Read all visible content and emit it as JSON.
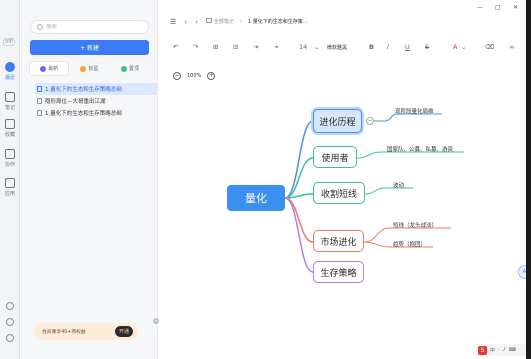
{
  "rail": {
    "badge": "VIP",
    "items": [
      {
        "label": "最近",
        "icon": "clock-icon",
        "active": true
      },
      {
        "label": "笔记",
        "icon": "note-icon",
        "active": false
      },
      {
        "label": "收藏",
        "icon": "bookmark-icon",
        "active": false
      },
      {
        "label": "协作",
        "icon": "team-icon",
        "active": false
      },
      {
        "label": "应用",
        "icon": "grid-icon",
        "active": false
      }
    ]
  },
  "sidebar": {
    "search_placeholder": "搜索",
    "new_button": "+ 新建",
    "tabs": [
      {
        "label": "最新",
        "color": "#7b5cf6"
      },
      {
        "label": "标星",
        "color": "#f6a623"
      },
      {
        "label": "置顶",
        "color": "#34c28a"
      }
    ],
    "files": [
      {
        "title": "1.量化下的生态和生存策略总纲",
        "active": true
      },
      {
        "title": "隐形周位—大哥重出江湖",
        "active": false
      },
      {
        "title": "1.量化下的生态和生存策略总纲",
        "active": false
      }
    ],
    "promo": {
      "text": "会员尊享40+项权益",
      "button": "开通"
    }
  },
  "header": {
    "breadcrumb_root": "全部笔记",
    "breadcrumb_current": "1.量化下的生态和生存策..."
  },
  "toolbar": {
    "font_size": "14",
    "font_family": "微软雅黑"
  },
  "zoom": {
    "level": "100%"
  },
  "mindmap": {
    "root": "量化",
    "branches": [
      {
        "label": "进化历程",
        "color": "#4a8ef0",
        "selected": true,
        "subs": [
          "现阶段量化局维"
        ]
      },
      {
        "label": "使用者",
        "color": "#3fbfa5",
        "selected": false,
        "subs": [
          "国家队、公募、私募、游资"
        ]
      },
      {
        "label": "收割短线",
        "color": "#3fbf86",
        "selected": false,
        "subs": [
          "波动"
        ]
      },
      {
        "label": "市场进化",
        "color": "#ef7b62",
        "selected": false,
        "subs": [
          "短线（龙头战法）",
          "趋势（抱团）"
        ]
      },
      {
        "label": "生存策略",
        "color": "#b07cf0",
        "selected": false,
        "subs": []
      }
    ]
  },
  "ime": {
    "label": "中"
  }
}
